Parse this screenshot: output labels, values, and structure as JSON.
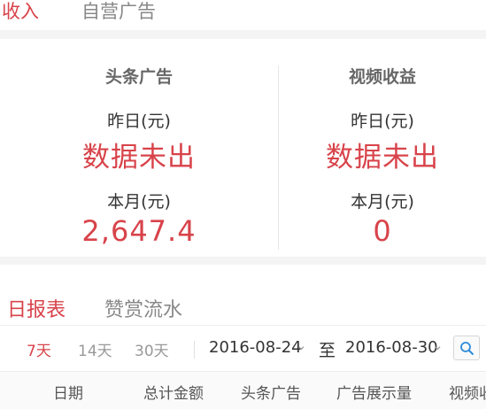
{
  "top_tabs": {
    "income": "收入",
    "self_ads": "自营广告"
  },
  "revenue": {
    "headline_ads": {
      "title": "头条广告",
      "yesterday_label": "昨日(元)",
      "yesterday_value": "数据未出",
      "month_label": "本月(元)",
      "month_value": "2,647.4"
    },
    "video_revenue": {
      "title": "视频收益",
      "yesterday_label": "昨日(元)",
      "yesterday_value": "数据未出",
      "month_label": "本月(元)",
      "month_value": "0"
    }
  },
  "report": {
    "tabs": {
      "daily": "日报表",
      "tips": "赞赏流水"
    },
    "filters": {
      "d7": "7天",
      "d14": "14天",
      "d30": "30天"
    },
    "date_from": "2016-08-24",
    "to_label": "至",
    "date_to": "2016-08-30",
    "columns": [
      "日期",
      "总计金额",
      "头条广告",
      "广告展示量",
      "视频收"
    ]
  },
  "colors": {
    "accent": "#d8434a"
  }
}
